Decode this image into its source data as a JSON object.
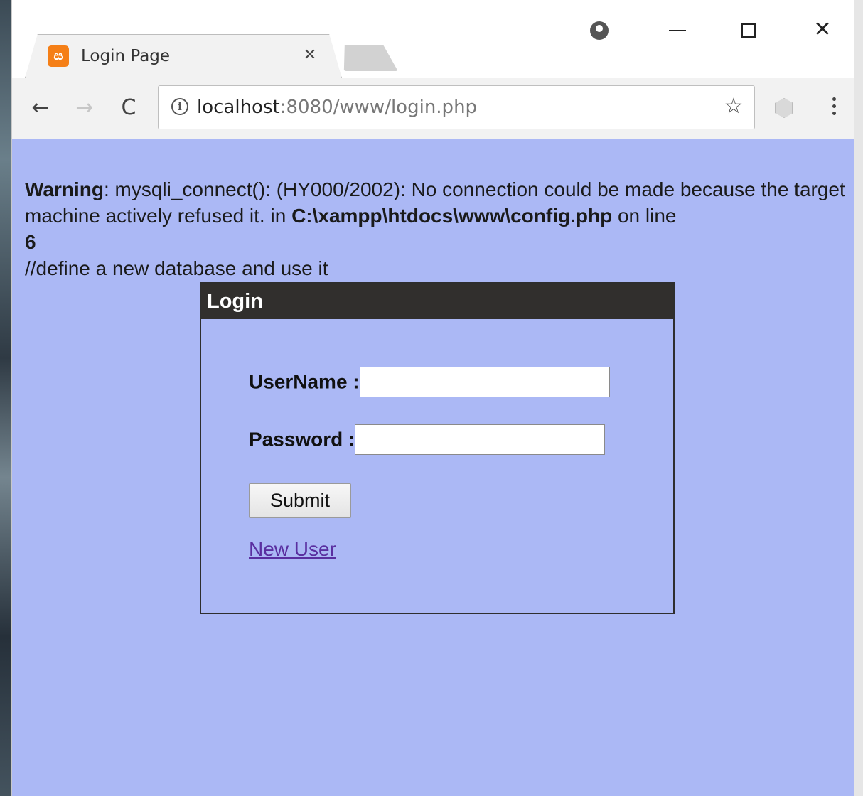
{
  "browser": {
    "tab": {
      "favicon_glyph": "ස",
      "title": "Login Page",
      "close_glyph": "✕"
    },
    "window_controls": {
      "profile_icon": "profile-icon",
      "minimize_icon": "minimize-icon",
      "maximize_icon": "maximize-icon",
      "close_glyph": "✕"
    },
    "toolbar": {
      "back_glyph": "←",
      "forward_glyph": "→",
      "reload_glyph": "C",
      "info_glyph": "i",
      "url_host": "localhost",
      "url_rest": ":8080/www/login.php",
      "star_glyph": "☆"
    }
  },
  "page": {
    "warning": {
      "label": "Warning",
      "text_before_path": ": mysqli_connect(): (HY000/2002): No connection could be made because the target machine actively refused it. in ",
      "path": "C:\\xampp\\htdocs\\www\\config.php",
      "text_after_path": " on line ",
      "line": "6"
    },
    "comment": "//define a new database and use it",
    "login": {
      "header": "Login",
      "username_label": "UserName :",
      "username_value": "",
      "password_label": "Password :",
      "password_value": "",
      "submit_label": "Submit",
      "new_user_link": "New User"
    }
  },
  "colors": {
    "page_background": "#abb8f5",
    "panel_header": "#312f2d",
    "link": "#5a2fa0",
    "favicon": "#f57f17"
  }
}
